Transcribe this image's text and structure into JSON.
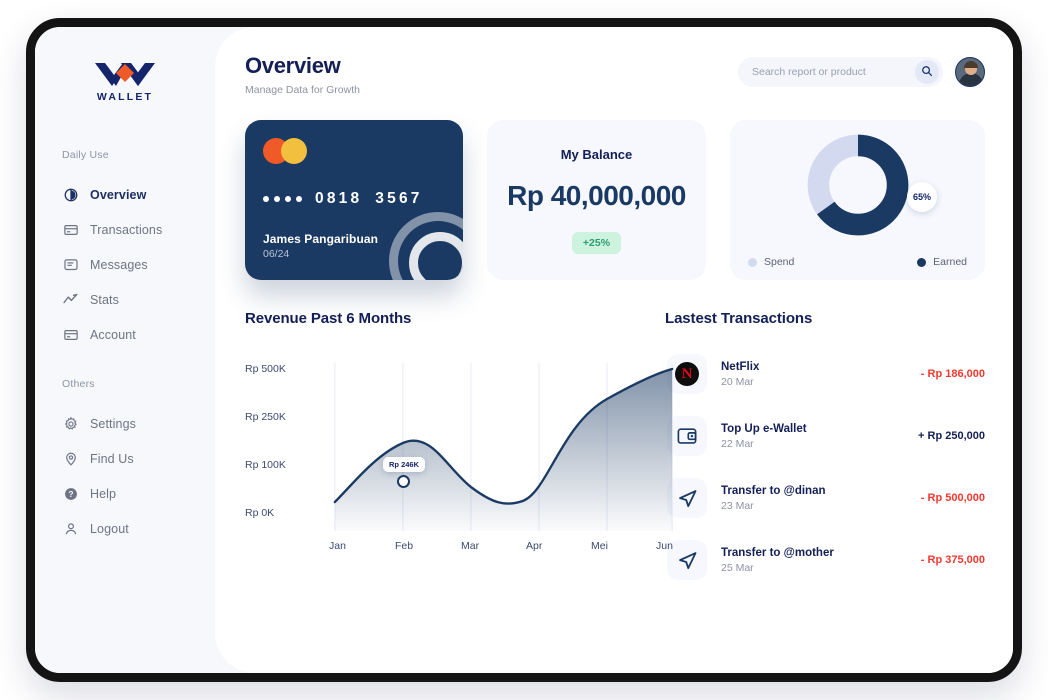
{
  "brand": {
    "name": "WALLET",
    "logo_icon": "wallet-w-logo",
    "navy": "#15246b",
    "orange": "#f05a28"
  },
  "sidebar": {
    "groups": [
      {
        "label": "Daily Use",
        "items": [
          {
            "label": "Overview",
            "icon": "pie-chart-icon",
            "active": true
          },
          {
            "label": "Transactions",
            "icon": "card-icon",
            "active": false
          },
          {
            "label": "Messages",
            "icon": "message-icon",
            "active": false
          },
          {
            "label": "Stats",
            "icon": "trend-line-icon",
            "active": false
          },
          {
            "label": "Account",
            "icon": "card-icon",
            "active": false
          }
        ]
      },
      {
        "label": "Others",
        "items": [
          {
            "label": "Settings",
            "icon": "gear-icon",
            "active": false
          },
          {
            "label": "Find Us",
            "icon": "location-pin-icon",
            "active": false
          },
          {
            "label": "Help",
            "icon": "help-circle-icon",
            "active": false
          },
          {
            "label": "Logout",
            "icon": "user-icon",
            "active": false
          }
        ]
      }
    ]
  },
  "header": {
    "title": "Overview",
    "subtitle": "Manage Data for Growth",
    "search": {
      "placeholder": "Search report or product",
      "value": "",
      "icon": "search-icon"
    },
    "avatar_alt": "user-avatar"
  },
  "credit_card": {
    "network_icon": "mastercard-icon",
    "masked_group": "••••",
    "number_part1": "0818",
    "number_part2": "3567",
    "holder": "James Pangaribuan",
    "expiry": "06/24",
    "bg_color": "#1b3a63"
  },
  "balance_card": {
    "title": "My Balance",
    "amount": "Rp 40,000,000",
    "delta": "+25%",
    "delta_color": "#2f9e6f"
  },
  "donut_card": {
    "badge": "65%",
    "legend": [
      {
        "label": "Spend",
        "color": "#d3d9ef"
      },
      {
        "label": "Earned",
        "color": "#1b3a63"
      }
    ]
  },
  "revenue": {
    "title": "Revenue Past 6 Months"
  },
  "transactions": {
    "title": "Lastest Transactions",
    "items": [
      {
        "name": "NetFlix",
        "date": "20 Mar",
        "amount": "- Rp 186,000",
        "sign": "neg",
        "icon": "netflix-icon"
      },
      {
        "name": "Top Up e-Wallet",
        "date": "22 Mar",
        "amount": "+ Rp 250,000",
        "sign": "pos",
        "icon": "wallet-icon"
      },
      {
        "name": "Transfer to @dinan",
        "date": "23 Mar",
        "amount": "- Rp 500,000",
        "sign": "neg",
        "icon": "send-icon"
      },
      {
        "name": "Transfer to @mother",
        "date": "25 Mar",
        "amount": "- Rp 375,000",
        "sign": "neg",
        "icon": "send-icon"
      }
    ]
  },
  "chart_data": [
    {
      "type": "area",
      "title": "Revenue Past 6 Months",
      "xlabel": "",
      "ylabel": "",
      "categories": [
        "Jan",
        "Feb",
        "Mar",
        "Apr",
        "Mei",
        "Jun"
      ],
      "values": [
        20,
        246,
        120,
        30,
        330,
        500
      ],
      "ytick_labels": [
        "Rp 500K",
        "Rp 250K",
        "Rp 100K",
        "Rp 0K"
      ],
      "ytick_values": [
        500,
        250,
        100,
        0
      ],
      "ylim": [
        0,
        500
      ],
      "grid": true,
      "legend": "none",
      "line_color": "#1b3a63",
      "annotation": {
        "label": "Rp 246K",
        "category": "Feb",
        "value": 246
      }
    },
    {
      "type": "pie",
      "title": "",
      "labels": [
        "Earned",
        "Spend"
      ],
      "values": [
        65,
        35
      ],
      "colors": [
        "#1b3a63",
        "#d3d9ef"
      ],
      "data_label": "65%",
      "legend": "bottom",
      "donut": true
    }
  ]
}
